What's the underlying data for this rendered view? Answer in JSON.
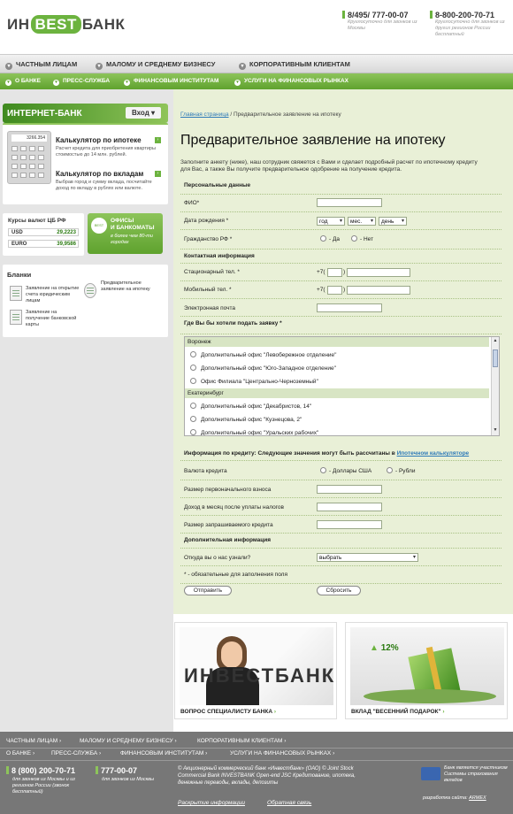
{
  "header": {
    "logo": {
      "part1": "ИН",
      "part2": "BEST",
      "part3": "БАНК"
    },
    "phone1": {
      "number": "8/495/ 777-00-07",
      "note": "Круглосуточно для звонков из Москвы"
    },
    "phone2": {
      "number": "8-800-200-70-71",
      "note": "Круглосуточно для звонков из других регионов России бесплатный"
    }
  },
  "nav_main": [
    "ЧАСТНЫМ ЛИЦАМ",
    "МАЛОМУ И СРЕДНЕМУ БИЗНЕСУ",
    "КОРПОРАТИВНЫМ КЛИЕНТАМ"
  ],
  "nav_sub": [
    "О БАНКЕ",
    "ПРЕСС-СЛУЖБА",
    "ФИНАНСОВЫМ ИНСТИТУТАМ",
    "УСЛУГИ НА ФИНАНСОВЫХ РЫНКАХ"
  ],
  "search": {
    "placeholder": "Поиск"
  },
  "sidebar": {
    "ibank": {
      "title": "ИНТЕРНЕТ-БАНК",
      "login": "Вход"
    },
    "calc_screen": "3266.354",
    "mortgage_calc": {
      "title": "Калькулятор по ипотеке",
      "desc": "Расчет кредита для приобретения квартиры стоимостью до 14 млн. рублей."
    },
    "deposit_calc": {
      "title": "Калькулятор по вкладам",
      "desc": "Выбрав город и сумму вклада, посчитайте доход по вкладу в рублях или валюте."
    },
    "rates": {
      "title": "Курсы валют ЦБ РФ",
      "usd_label": "USD",
      "usd": "29,2223",
      "eur_label": "EURO",
      "eur": "39,9586"
    },
    "offices": {
      "icon": "BEST",
      "title1": "ОФИСЫ",
      "title2": "И БАНКОМАТЫ",
      "sub": "в более чем 80-ти городах"
    },
    "blanks": {
      "title": "Бланки",
      "item1": "Заявление на открытие счета юридическим лицам",
      "item2": "Заявление на получение банковской карты",
      "item3": "Предварительное заявление на ипотеку"
    }
  },
  "breadcrumb": {
    "home": "Главная страница",
    "sep": "/",
    "current": "Предварительное заявление на ипотеку"
  },
  "page_title": "Предварительное заявление на ипотеку",
  "intro": "Заполните анкету (ниже), наш сотрудник свяжется с Вами и сделает подробный расчет по ипотечному кредиту для Вас, а также Вы получите предварительное одобрение на получение кредита.",
  "form": {
    "sec_personal": "Персональные данные",
    "fio": "ФИО*",
    "dob": "Дата рождения *",
    "dob_year": "год",
    "dob_month": "мес.",
    "dob_day": "день",
    "citizen": "Гражданство РФ *",
    "yes": "- Да",
    "no": "- Нет",
    "sec_contact": "Контактная информация",
    "home_phone": "Стационарный тел. *",
    "mobile_phone": "Мобильный тел. *",
    "phone_prefix": "+7(",
    "phone_close": ")",
    "email": "Электронная почта",
    "sec_where": "Где Вы бы хотели подать заявку *",
    "cities": [
      {
        "name": "Воронеж",
        "offices": [
          "Дополнительный офис \"Левобережное отделение\"",
          "Дополнительный офис \"Юго-Западное отделение\"",
          "Офис Филиала \"Центрально-Черноземный\""
        ]
      },
      {
        "name": "Екатеринбург",
        "offices": [
          "Дополнительный офис \"Декабристов, 14\"",
          "Дополнительный офис \"Кузнецова, 2\"",
          "Дополнительный офис \"Уральских рабочих\""
        ]
      }
    ],
    "sec_credit": "Информация по кредиту: Следующие значения могут быть рассчитаны в",
    "credit_link": "Ипотечном калькуляторе",
    "currency": "Валюта кредита",
    "usd": "- Доллары США",
    "rub": "- Рубли",
    "down": "Размер первоначального взноса",
    "income": "Доход в месяц после уплаты налогов",
    "amount": "Размер запрашиваемого кредита",
    "sec_extra": "Дополнительная информация",
    "source": "Откуда вы о нас узнали?",
    "source_value": "выбрать",
    "required_note": "* - обязательные для заполнения поля",
    "submit": "Отправить",
    "reset": "Сбросить"
  },
  "promos": {
    "left_caption": "ВОПРОС СПЕЦИАЛИСТУ БАНКА",
    "left_logo": "ИНВЕСТБАНК",
    "right_caption": "ВКЛАД \"ВЕСЕННИЙ ПОДАРОК\"",
    "right_rate": "12%"
  },
  "footer": {
    "nav_main": [
      "ЧАСТНЫМ ЛИЦАМ",
      "МАЛОМУ И СРЕДНЕМУ БИЗНЕСУ",
      "КОРПОРАТИВНЫМ КЛИЕНТАМ"
    ],
    "nav_sub": [
      "О БАНКЕ",
      "ПРЕСС-СЛУЖБА",
      "ФИНАНСОВЫМ ИНСТИТУТАМ",
      "УСЛУГИ НА ФИНАНСОВЫХ РЫНКАХ"
    ],
    "phone1": "8 (800) 200-70-71",
    "phone1_note": "для звонков из Москвы и из регионов России (звонок бесплатный)",
    "phone2": "777-00-07",
    "phone2_note": "для звонков из Москвы",
    "copyright": "© Акционерный коммерческий банк «Инвестбанк» (ОАО) © Joint Stock Commercial Bank INVESTBANK Open-end JSC Кредитование, ипотека, денежные переводы, вклады, депозиты",
    "disclosure": "Раскрытие информации",
    "feedback": "Обратная связь",
    "insurance": "Банк является участником Системы страхования вкладов",
    "dev": "разработка сайта:",
    "dev_name": "ARMEX"
  }
}
